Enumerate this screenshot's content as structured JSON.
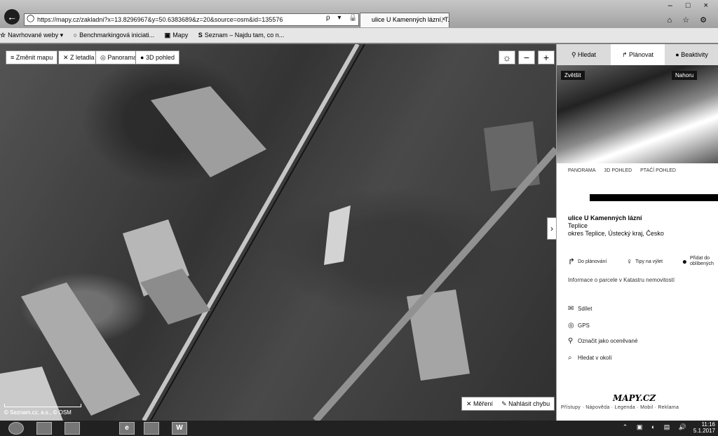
{
  "browser": {
    "url": "https://mapy.cz/zakladni?x=13.8296967&y=50.6383689&z=20&source=osm&id=135576",
    "tab_title": "ulice U Kamenných lázní, T...",
    "tab_close": "×",
    "window_controls": "– □ ×",
    "right_icons": "⌂ ☆ ⚙",
    "addr_tools": "ρ ▾ 🔒 C",
    "favorites": [
      {
        "icon": "☆",
        "label": "Navrhované weby ▾"
      },
      {
        "icon": "○",
        "label": "Benchmarkingová iniciati..."
      },
      {
        "icon": "▣",
        "label": "Mapy"
      },
      {
        "icon": "S",
        "label": "Seznam – Najdu tam, co n..."
      }
    ]
  },
  "map": {
    "change_map": "Změnit mapu",
    "buttons": [
      "Z letadla",
      "Panorama",
      "3D pohled"
    ],
    "zoom_out": "−",
    "zoom_in": "+",
    "bottom_buttons": [
      "Měření",
      "Nahlásit chybu"
    ],
    "scale_label": "© Seznam.cz, a.s., © OSM"
  },
  "panel": {
    "tabs": [
      "Hledat",
      "Plánovat",
      "Beaktivity"
    ],
    "pano_expand": "Zvětšit",
    "pano_open": "Nahoru",
    "view_tabs": [
      "PANORAMA",
      "3D POHLED",
      "PTAČÍ POHLED"
    ],
    "address": {
      "title": "ulice U Kamenných lázní",
      "city": "Teplice",
      "region": "okres Teplice, Ústecký kraj, Česko"
    },
    "actions": [
      {
        "icon": "↱",
        "label": "Do plánování"
      },
      {
        "icon": "♀",
        "label": "Tipy na výlet"
      },
      {
        "icon": "●",
        "label": "Přidat do oblíbených"
      }
    ],
    "cadastre": "Informace o parcele v Katastru nemovitostí",
    "menu": [
      {
        "icon": "✉",
        "label": "Sdílet"
      },
      {
        "icon": "◎",
        "label": "GPS"
      },
      {
        "icon": "⚲",
        "label": "Označit jako oceněvané"
      },
      {
        "icon": "⌕",
        "label": "Hledat v okolí"
      }
    ],
    "brand": "MAPY.CZ",
    "footer": "Přístupy · Nápověda · Legenda · Mobil · Reklama"
  },
  "taskbar": {
    "apps": [
      "",
      "",
      "",
      "e",
      "",
      "W"
    ],
    "tray": "⌃ ▣ ◐ ▤ 🔊",
    "time": "11:16",
    "date": "5.1.2017"
  }
}
